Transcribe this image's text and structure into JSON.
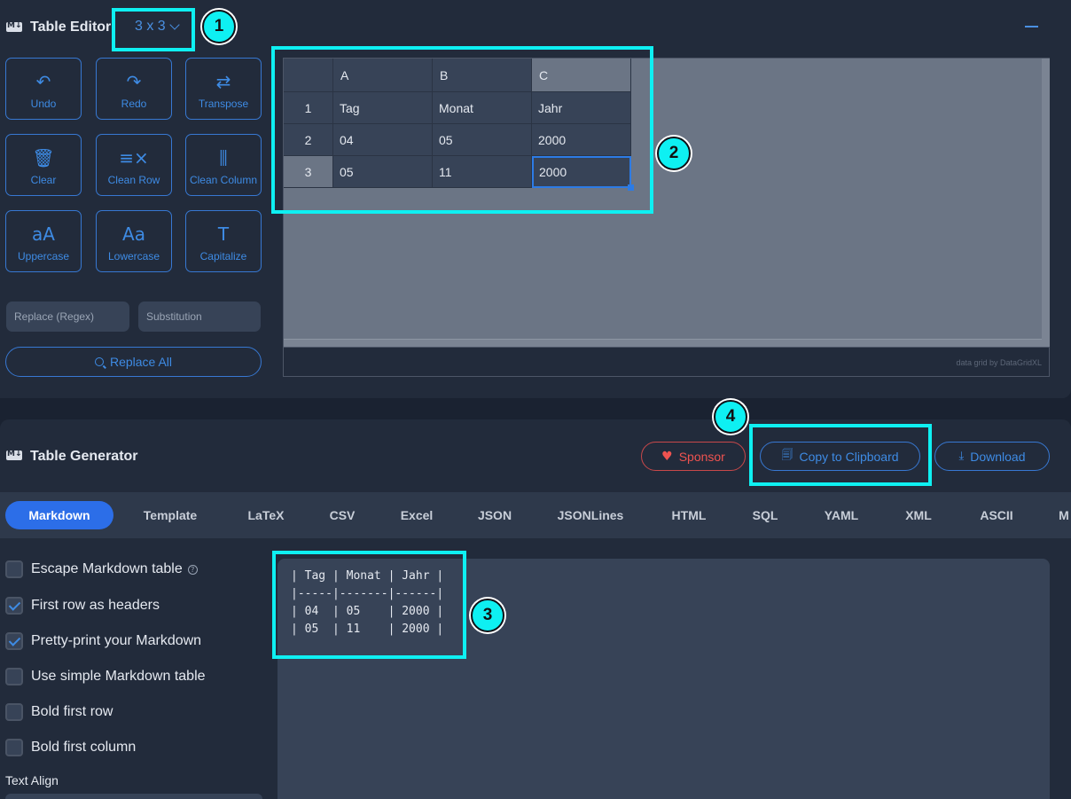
{
  "editor": {
    "title": "Table Editor",
    "size_select": "3 x 3",
    "tools": [
      {
        "label": "Undo",
        "icon": "undo-icon",
        "glyph": "↶"
      },
      {
        "label": "Redo",
        "icon": "redo-icon",
        "glyph": "↷"
      },
      {
        "label": "Transpose",
        "icon": "transpose-icon",
        "glyph": "⇄"
      },
      {
        "label": "Clear",
        "icon": "trash-icon",
        "glyph": "🗑"
      },
      {
        "label": "Clean Row",
        "icon": "clean-row-icon",
        "glyph": "≡×"
      },
      {
        "label": "Clean Column",
        "icon": "clean-column-icon",
        "glyph": "⫼"
      },
      {
        "label": "Uppercase",
        "icon": "uppercase-icon",
        "glyph": "aA"
      },
      {
        "label": "Lowercase",
        "icon": "lowercase-icon",
        "glyph": "Aa"
      },
      {
        "label": "Capitalize",
        "icon": "capitalize-icon",
        "glyph": "T"
      }
    ],
    "replace_placeholder": "Replace (Regex)",
    "substitution_placeholder": "Substitution",
    "replace_all_label": "Replace All"
  },
  "grid": {
    "columns": [
      "A",
      "B",
      "C"
    ],
    "row_numbers": [
      "1",
      "2",
      "3"
    ],
    "rows": [
      [
        "Tag",
        "Monat",
        "Jahr"
      ],
      [
        "04",
        "05",
        "2000"
      ],
      [
        "05",
        "11",
        "2000"
      ]
    ],
    "selected_cell": "C3",
    "credit": "data grid by DataGridXL"
  },
  "generator": {
    "title": "Table Generator",
    "sponsor_label": "Sponsor",
    "copy_label": "Copy to Clipboard",
    "download_label": "Download",
    "tabs": [
      "Markdown",
      "Template",
      "LaTeX",
      "CSV",
      "Excel",
      "JSON",
      "JSONLines",
      "HTML",
      "SQL",
      "YAML",
      "XML",
      "ASCII",
      "M"
    ],
    "active_tab": "Markdown",
    "options": [
      {
        "label": "Escape Markdown table",
        "checked": false,
        "help": true
      },
      {
        "label": "First row as headers",
        "checked": true
      },
      {
        "label": "Pretty-print your Markdown",
        "checked": true
      },
      {
        "label": "Use simple Markdown table",
        "checked": false
      },
      {
        "label": "Bold first row",
        "checked": false
      },
      {
        "label": "Bold first column",
        "checked": false
      }
    ],
    "text_align_label": "Text Align",
    "output": "| Tag | Monat | Jahr |\n|-----|-------|------|\n| 04  | 05    | 2000 |\n| 05  | 11    | 2000 |"
  },
  "annotations": [
    "1",
    "2",
    "3",
    "4"
  ],
  "colors": {
    "highlight": "#0ef0f2",
    "accent": "#3e8be4",
    "sponsor": "#ef5350",
    "panel": "#222b3b"
  }
}
